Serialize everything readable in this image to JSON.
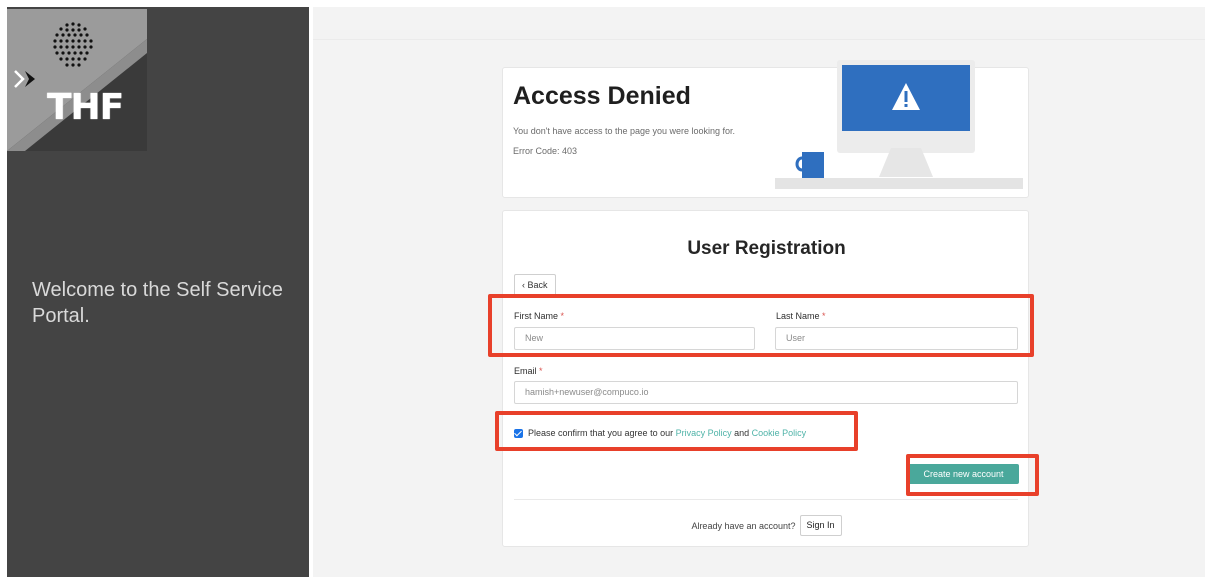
{
  "sidebar": {
    "logo_text": "THF",
    "welcome": "Welcome to the Self Service Portal."
  },
  "access_denied": {
    "title": "Access Denied",
    "message": "You don't have access to the page you were looking for.",
    "error_code": "Error Code: 403"
  },
  "registration": {
    "title": "User Registration",
    "back_label": "Back",
    "first_name_label": "First Name",
    "first_name_value": "New",
    "last_name_label": "Last Name",
    "last_name_value": "User",
    "email_label": "Email",
    "email_value": "hamish+newuser@compuco.io",
    "required_mark": "*",
    "agree_prefix": "Please confirm that you agree to our ",
    "privacy_link": "Privacy Policy",
    "agree_and": " and ",
    "cookie_link": "Cookie Policy",
    "agree_checked": true,
    "create_button": "Create new account",
    "already_text": "Already have an account?",
    "signin_button": "Sign In"
  },
  "colors": {
    "sidebar_bg": "#444444",
    "accent_teal": "#4aa89b",
    "highlight_red": "#e8402a",
    "monitor_blue": "#2f6fbf"
  }
}
